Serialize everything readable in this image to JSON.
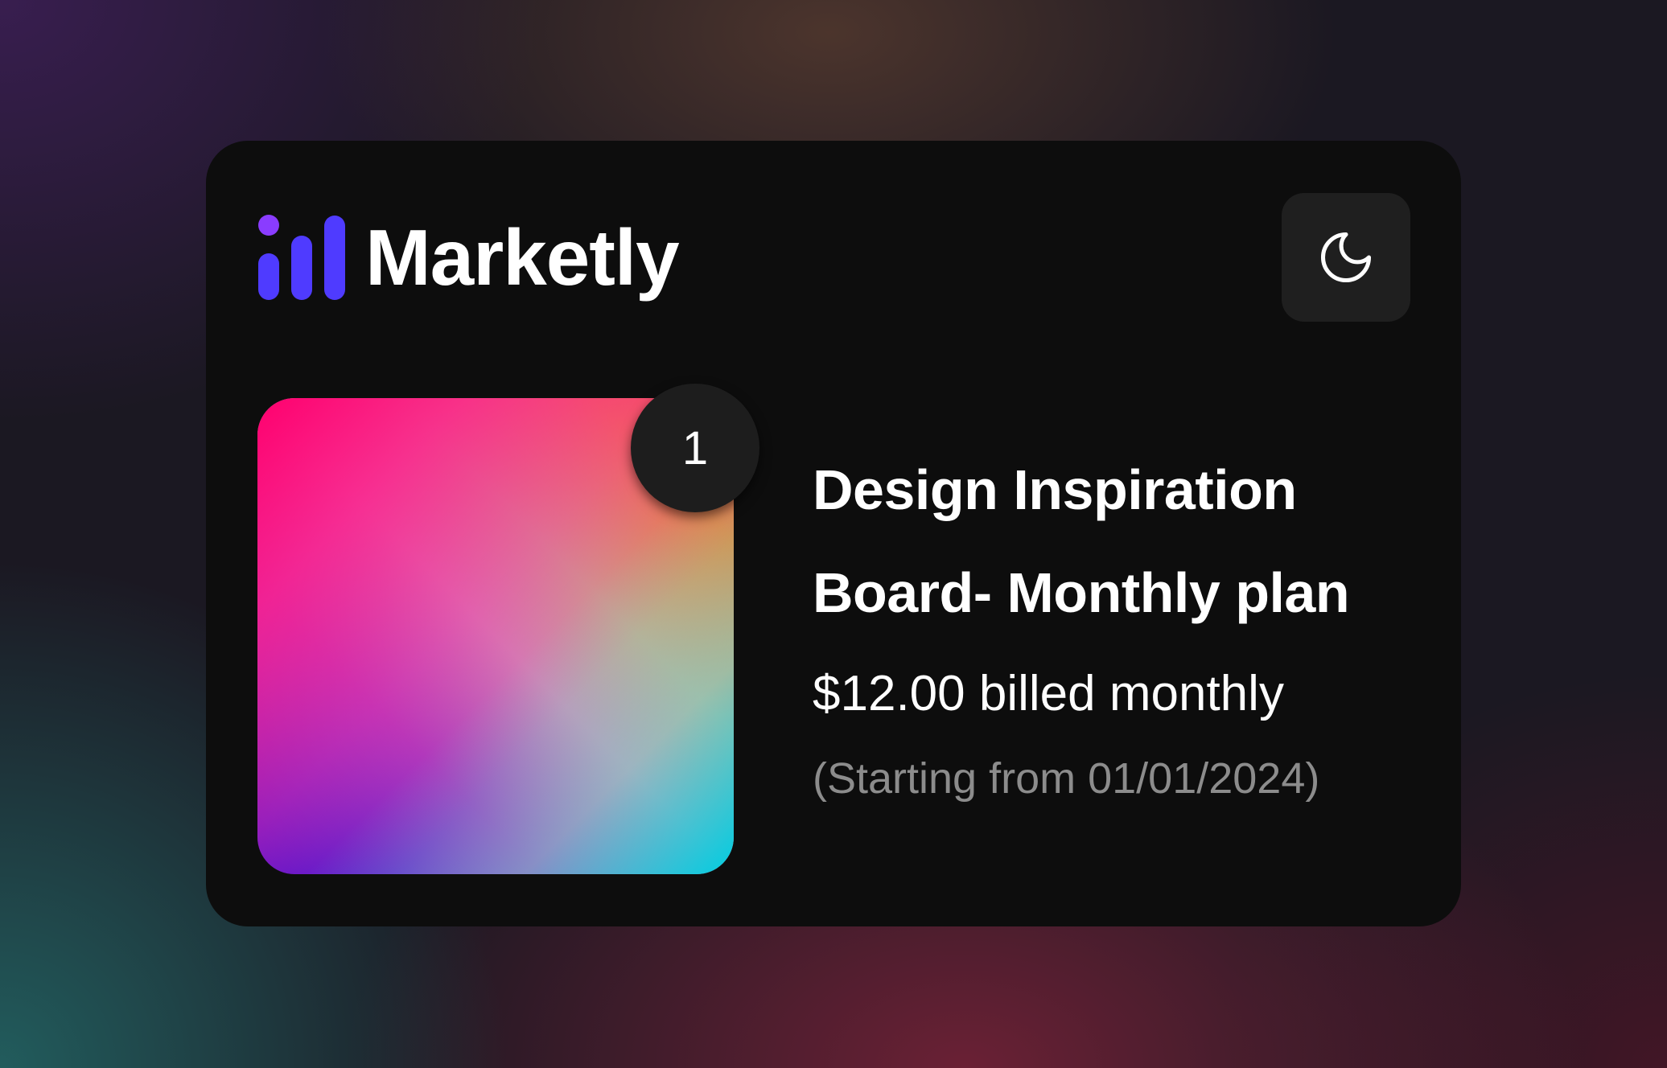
{
  "brand": {
    "name": "Marketly",
    "logo_icon": "bar-chart-logo-icon",
    "colors": {
      "logo_dot": "#8a3cff",
      "logo_bars": "#4f3bff"
    }
  },
  "theme_toggle": {
    "icon": "moon-icon"
  },
  "order_item": {
    "quantity": "1",
    "title": "Design Inspiration Board- Monthly plan",
    "price_text": "$12.00 billed monthly",
    "start_text": "(Starting from 01/01/2024)"
  },
  "colors": {
    "card_background": "#0d0d0d",
    "toggle_background": "#1f1f1f",
    "muted_text": "#8c8c8c"
  }
}
